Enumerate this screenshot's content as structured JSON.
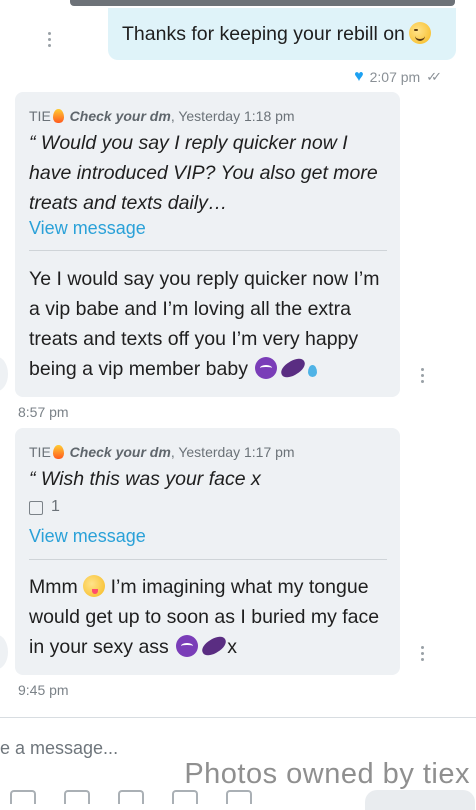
{
  "sent_message": {
    "text": "Thanks for keeping your rebill on",
    "emoji": "wink-emoji"
  },
  "sent_meta": {
    "time": "2:07 pm"
  },
  "messages": [
    {
      "author": "TIE",
      "tag": "Check your dm",
      "when": ", Yesterday 1:18 pm",
      "quote": "“ Would you say I reply quicker now I have introduced VIP? You also get more treats and texts daily…",
      "view_label": "View message",
      "reply": "Ye I would say you reply quicker now I’m a vip babe and I’m loving all the extra treats and texts off you I’m very happy being a vip member baby",
      "time": "8:57 pm"
    },
    {
      "author": "TIE",
      "tag": "Check your dm",
      "when": ", Yesterday 1:17 pm",
      "quote": "“ Wish this was your face x",
      "media_count": "1",
      "view_label": "View message",
      "reply_part1": "Mmm",
      "reply_part2": "I’m imagining what my tongue would get up to soon as I buried my face in your sexy ass",
      "reply_suffix": "x",
      "time": "9:45 pm"
    }
  ],
  "composer": {
    "placeholder": "e a message..."
  },
  "watermark": "Photos owned by tiex"
}
